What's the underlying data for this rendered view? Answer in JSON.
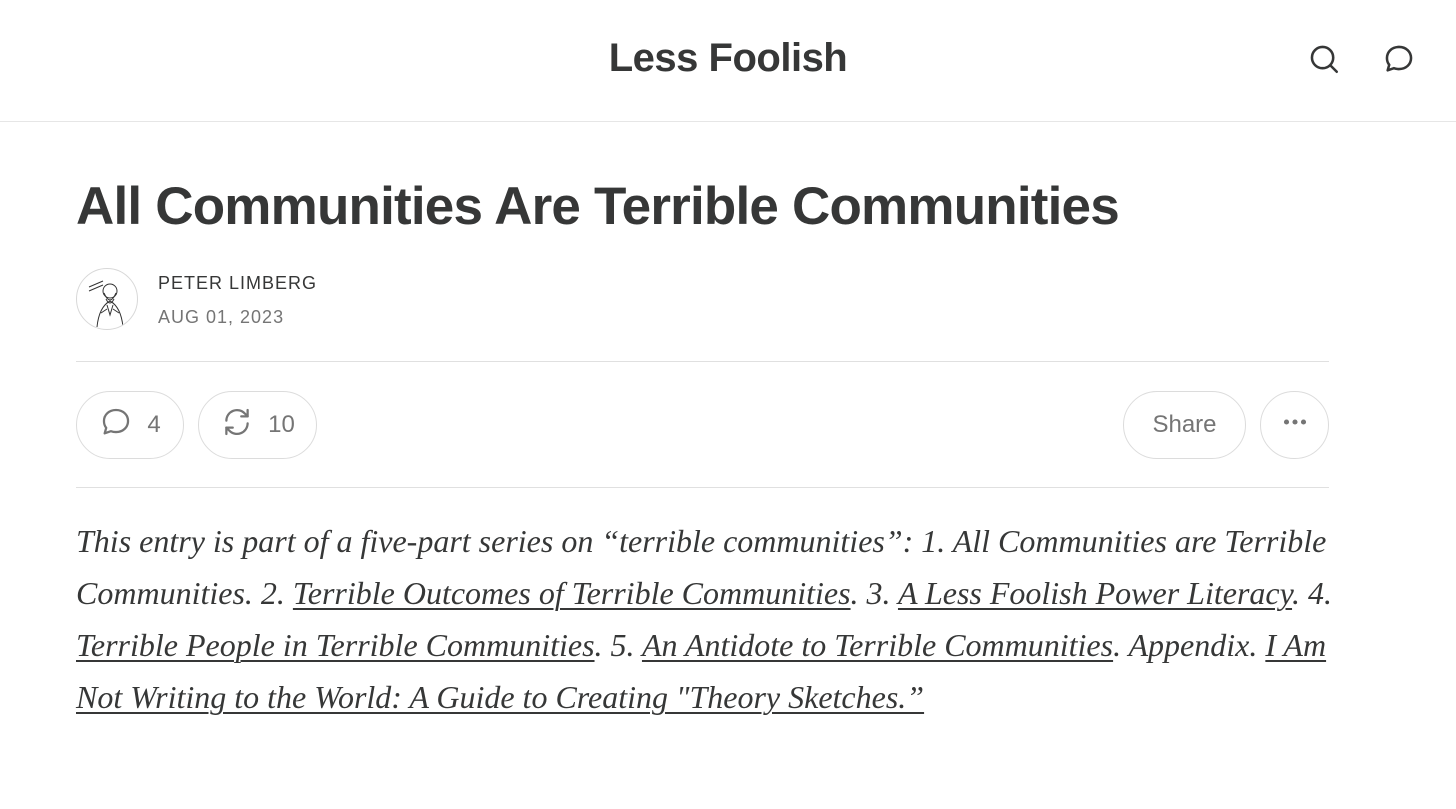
{
  "header": {
    "site_title": "Less Foolish",
    "search_icon": "search-icon",
    "chat_icon": "chat-bubble-icon"
  },
  "post": {
    "title": "All Communities Are Terrible Communities",
    "author": "PETER LIMBERG",
    "date": "AUG 01, 2023",
    "avatar_icon": "author-portrait-sketch"
  },
  "actions": {
    "comments_count": "4",
    "restacks_count": "10",
    "share_label": "Share",
    "more_icon": "ellipsis-icon"
  },
  "intro": {
    "t1": "This entry is part of a five-part series on “terrible communities”: 1. All Communities are Terrible Communities. 2. ",
    "link1": "Terrible Outcomes of Terrible Communities",
    "t2": ". 3. ",
    "link2": "A Less Foolish Power Literacy",
    "t3": ". 4. ",
    "link3": "Terrible People in Terrible Communities",
    "t4": ". 5. ",
    "link4": "An Antidote to Terrible Communities",
    "t5": ". Appendix. ",
    "link5": "I Am Not Writing to the World: A Guide to Creating \"Theory Sketches.”"
  },
  "colors": {
    "text": "#363737",
    "muted": "#757575",
    "border": "#dcdcdc"
  }
}
